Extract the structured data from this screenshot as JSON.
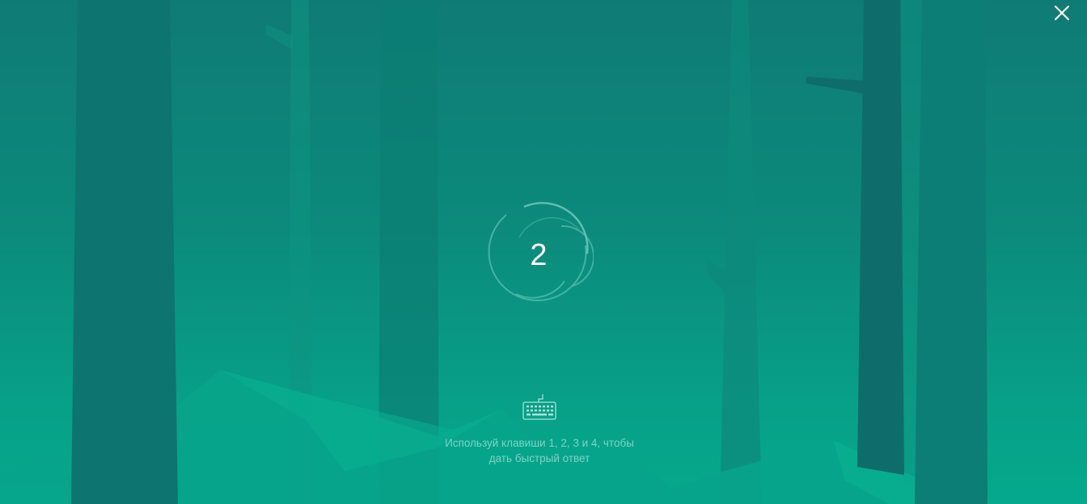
{
  "countdown": {
    "value": "2"
  },
  "hint": {
    "line1": "Используй клавиши 1, 2, 3 и 4, чтобы",
    "line2": "дать быстрый ответ"
  },
  "icons": {
    "close": "close-icon",
    "keyboard": "keyboard-icon"
  },
  "colors": {
    "background_top": "#0f7b75",
    "background_bottom": "#05a98c",
    "hint_text": "#7fd3c4",
    "countdown_text": "#ffffff"
  }
}
